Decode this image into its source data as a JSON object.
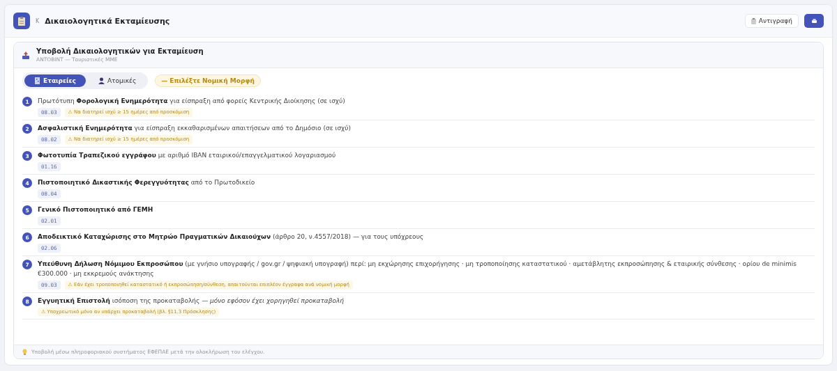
{
  "header": {
    "prefix": "K",
    "title": "Δικαιολογητικά Εκταμίευσης",
    "copy_button": "Αντιγραφή"
  },
  "card": {
    "title": "Υποβολή Δικαιολογητικών για Εκταμίευση",
    "subtitle": "ΑΝΤΟΒΙΝΤ — Τουριστικές ΜΜΕ",
    "tabs": [
      {
        "label": "Εταιρείες",
        "selected": true,
        "kind": "company"
      },
      {
        "label": "Ατομικές",
        "selected": false,
        "kind": "person"
      }
    ],
    "hint": "— Επιλέξτε Νομική Μορφή",
    "items": [
      {
        "number": "1",
        "text": "Πρωτότυπη **Φορολογική Ενημερότητα** για είσπραξη από φορείς Κεντρικής Διοίκησης (σε ισχύ)",
        "code": "08.03",
        "warning": "⚠ Να διατηρεί ισχύ ≥ 15 ημέρες από προσκόμιση"
      },
      {
        "number": "2",
        "text": "**Ασφαλιστική Ενημερότητα** για είσπραξη εκκαθαρισμένων απαιτήσεων από το Δημόσιο (σε ισχύ)",
        "code": "08.02",
        "warning": "⚠ Να διατηρεί ισχύ ≥ 15 ημέρες από προσκόμιση"
      },
      {
        "number": "3",
        "text": "**Φωτοτυπία Τραπεζικού εγγράφου** με αριθμό IBAN εταιρικού/επαγγελματικού λογαριασμού",
        "code": "01.16"
      },
      {
        "number": "4",
        "text": "**Πιστοποιητικό Δικαστικής Φερεγγυότητας** από το Πρωτοδικείο",
        "code": "08.04"
      },
      {
        "number": "5",
        "text": "**Γενικό Πιστοποιητικό από ΓΕΜΗ**",
        "code": "02.01"
      },
      {
        "number": "6",
        "text": "**Αποδεικτικό Καταχώρισης στο Μητρώο Πραγματικών Δικαιούχων** (άρθρο 20, ν.4557/2018) — για τους υπόχρεους",
        "code": "02.06"
      },
      {
        "number": "7",
        "text": "**Υπεύθυνη Δήλωση Νόμιμου Εκπροσώπου** (με γνήσιο υπογραφής / gov.gr / ψηφιακή υπογραφή) περί: μη εκχώρησης επιχορήγησης · μη τροποποίησης καταστατικού · αμετάβλητης εκπροσώπησης & εταιρικής σύνθεσης · ορίου de minimis €300.000 · μη εκκρεμούς ανάκτησης",
        "code": "09.03",
        "warning": "⚠ Εάν έχει τροποποιηθεί καταστατικό ή εκπροσώπηση/σύνθεση, απαιτούνται επιπλέον έγγραφα ανά νομική μορφή"
      },
      {
        "number": "8",
        "text": "**Εγγυητική Επιστολή** ισόποση της προκαταβολής — *μόνο εφόσον έχει χορηγηθεί προκαταβολή*",
        "warning": "⚠ Υποχρεωτικό μόνο αν υπάρχει προκαταβολή (βλ. §11.3 Πρόσκλησης)"
      }
    ],
    "footer": "Υποβολή μέσω πληροφοριακού συστήματος ΕΦΕΠΑΕ μετά την ολοκλήρωση του ελέγχου."
  }
}
